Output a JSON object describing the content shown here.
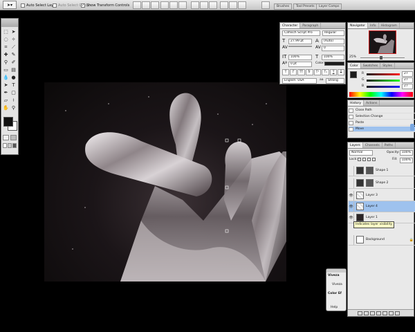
{
  "options_bar": {
    "auto_select_layer": "Auto Select Layer",
    "auto_select_groups": "Auto Select Groups",
    "show_transform_controls": "Show Transform Controls",
    "wells": [
      "Brushes",
      "Tool Presets",
      "Layer Comps"
    ]
  },
  "character": {
    "tabs": [
      "Character",
      "Paragraph"
    ],
    "font_family": "Caflisch Script Pro",
    "font_style": "Regular",
    "font_size": "27.99 pt",
    "leading": "(Auto)",
    "kerning": "0",
    "vertical_scale": "100%",
    "horizontal_scale": "100%",
    "baseline_shift": "0 pt",
    "color_label": "Color:",
    "language": "English: USA",
    "anti_alias": "Strong",
    "style_buttons": [
      "T",
      "T",
      "TT",
      "Tr",
      "T¹",
      "T₁",
      "T",
      "T"
    ]
  },
  "navigator": {
    "tabs": [
      "Navigator",
      "Info",
      "Histogram"
    ],
    "zoom": "25%"
  },
  "color": {
    "tabs": [
      "Color",
      "Swatches",
      "Styles"
    ],
    "r_value": "27",
    "g_value": "27",
    "b_value": "27"
  },
  "history": {
    "tabs": [
      "History",
      "Actions"
    ],
    "items": [
      "Close Path",
      "Selection Change",
      "Paste",
      "Move"
    ],
    "selected": 3
  },
  "layers": {
    "tabs": [
      "Layers",
      "Channels",
      "Paths"
    ],
    "blend_mode": "Normal",
    "opacity_label": "Opacity:",
    "opacity": "100%",
    "lock_label": "Lock:",
    "fill_label": "Fill:",
    "fill": "100%",
    "items": [
      "Shape 1",
      "Shape 2",
      "Layer 3",
      "Layer 4",
      "Layer 1",
      "Background"
    ],
    "selected": 3,
    "tooltip": "Indicates layer visibility"
  },
  "viveza": {
    "title": "Viveza",
    "name": "Viveza",
    "color_section": "Color Ef",
    "help": "Help"
  },
  "colors": {
    "selection": "#9ec2ee",
    "panel_bg": "#e9e9e9",
    "fg": "#1b1b1b",
    "bg": "#ffffff"
  }
}
